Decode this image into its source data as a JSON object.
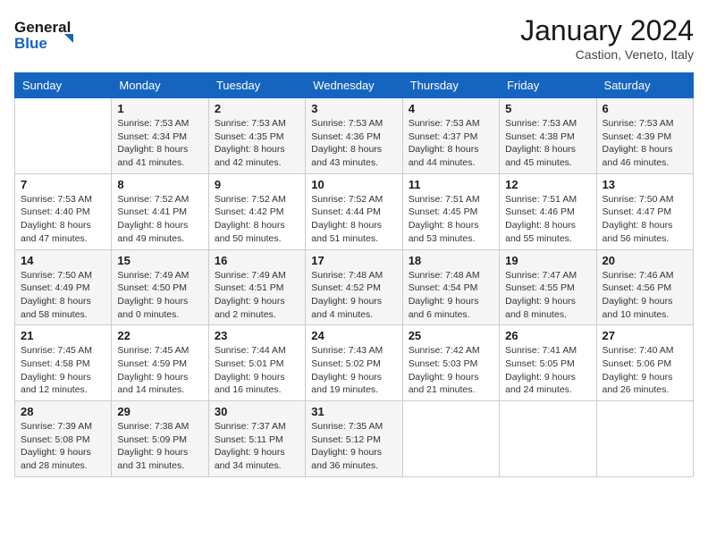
{
  "logo": {
    "line1": "General",
    "line2": "Blue"
  },
  "title": "January 2024",
  "subtitle": "Castion, Veneto, Italy",
  "days_header": [
    "Sunday",
    "Monday",
    "Tuesday",
    "Wednesday",
    "Thursday",
    "Friday",
    "Saturday"
  ],
  "weeks": [
    [
      {
        "num": "",
        "detail": ""
      },
      {
        "num": "1",
        "detail": "Sunrise: 7:53 AM\nSunset: 4:34 PM\nDaylight: 8 hours\nand 41 minutes."
      },
      {
        "num": "2",
        "detail": "Sunrise: 7:53 AM\nSunset: 4:35 PM\nDaylight: 8 hours\nand 42 minutes."
      },
      {
        "num": "3",
        "detail": "Sunrise: 7:53 AM\nSunset: 4:36 PM\nDaylight: 8 hours\nand 43 minutes."
      },
      {
        "num": "4",
        "detail": "Sunrise: 7:53 AM\nSunset: 4:37 PM\nDaylight: 8 hours\nand 44 minutes."
      },
      {
        "num": "5",
        "detail": "Sunrise: 7:53 AM\nSunset: 4:38 PM\nDaylight: 8 hours\nand 45 minutes."
      },
      {
        "num": "6",
        "detail": "Sunrise: 7:53 AM\nSunset: 4:39 PM\nDaylight: 8 hours\nand 46 minutes."
      }
    ],
    [
      {
        "num": "7",
        "detail": "Sunrise: 7:53 AM\nSunset: 4:40 PM\nDaylight: 8 hours\nand 47 minutes."
      },
      {
        "num": "8",
        "detail": "Sunrise: 7:52 AM\nSunset: 4:41 PM\nDaylight: 8 hours\nand 49 minutes."
      },
      {
        "num": "9",
        "detail": "Sunrise: 7:52 AM\nSunset: 4:42 PM\nDaylight: 8 hours\nand 50 minutes."
      },
      {
        "num": "10",
        "detail": "Sunrise: 7:52 AM\nSunset: 4:44 PM\nDaylight: 8 hours\nand 51 minutes."
      },
      {
        "num": "11",
        "detail": "Sunrise: 7:51 AM\nSunset: 4:45 PM\nDaylight: 8 hours\nand 53 minutes."
      },
      {
        "num": "12",
        "detail": "Sunrise: 7:51 AM\nSunset: 4:46 PM\nDaylight: 8 hours\nand 55 minutes."
      },
      {
        "num": "13",
        "detail": "Sunrise: 7:50 AM\nSunset: 4:47 PM\nDaylight: 8 hours\nand 56 minutes."
      }
    ],
    [
      {
        "num": "14",
        "detail": "Sunrise: 7:50 AM\nSunset: 4:49 PM\nDaylight: 8 hours\nand 58 minutes."
      },
      {
        "num": "15",
        "detail": "Sunrise: 7:49 AM\nSunset: 4:50 PM\nDaylight: 9 hours\nand 0 minutes."
      },
      {
        "num": "16",
        "detail": "Sunrise: 7:49 AM\nSunset: 4:51 PM\nDaylight: 9 hours\nand 2 minutes."
      },
      {
        "num": "17",
        "detail": "Sunrise: 7:48 AM\nSunset: 4:52 PM\nDaylight: 9 hours\nand 4 minutes."
      },
      {
        "num": "18",
        "detail": "Sunrise: 7:48 AM\nSunset: 4:54 PM\nDaylight: 9 hours\nand 6 minutes."
      },
      {
        "num": "19",
        "detail": "Sunrise: 7:47 AM\nSunset: 4:55 PM\nDaylight: 9 hours\nand 8 minutes."
      },
      {
        "num": "20",
        "detail": "Sunrise: 7:46 AM\nSunset: 4:56 PM\nDaylight: 9 hours\nand 10 minutes."
      }
    ],
    [
      {
        "num": "21",
        "detail": "Sunrise: 7:45 AM\nSunset: 4:58 PM\nDaylight: 9 hours\nand 12 minutes."
      },
      {
        "num": "22",
        "detail": "Sunrise: 7:45 AM\nSunset: 4:59 PM\nDaylight: 9 hours\nand 14 minutes."
      },
      {
        "num": "23",
        "detail": "Sunrise: 7:44 AM\nSunset: 5:01 PM\nDaylight: 9 hours\nand 16 minutes."
      },
      {
        "num": "24",
        "detail": "Sunrise: 7:43 AM\nSunset: 5:02 PM\nDaylight: 9 hours\nand 19 minutes."
      },
      {
        "num": "25",
        "detail": "Sunrise: 7:42 AM\nSunset: 5:03 PM\nDaylight: 9 hours\nand 21 minutes."
      },
      {
        "num": "26",
        "detail": "Sunrise: 7:41 AM\nSunset: 5:05 PM\nDaylight: 9 hours\nand 24 minutes."
      },
      {
        "num": "27",
        "detail": "Sunrise: 7:40 AM\nSunset: 5:06 PM\nDaylight: 9 hours\nand 26 minutes."
      }
    ],
    [
      {
        "num": "28",
        "detail": "Sunrise: 7:39 AM\nSunset: 5:08 PM\nDaylight: 9 hours\nand 28 minutes."
      },
      {
        "num": "29",
        "detail": "Sunrise: 7:38 AM\nSunset: 5:09 PM\nDaylight: 9 hours\nand 31 minutes."
      },
      {
        "num": "30",
        "detail": "Sunrise: 7:37 AM\nSunset: 5:11 PM\nDaylight: 9 hours\nand 34 minutes."
      },
      {
        "num": "31",
        "detail": "Sunrise: 7:35 AM\nSunset: 5:12 PM\nDaylight: 9 hours\nand 36 minutes."
      },
      {
        "num": "",
        "detail": ""
      },
      {
        "num": "",
        "detail": ""
      },
      {
        "num": "",
        "detail": ""
      }
    ]
  ]
}
